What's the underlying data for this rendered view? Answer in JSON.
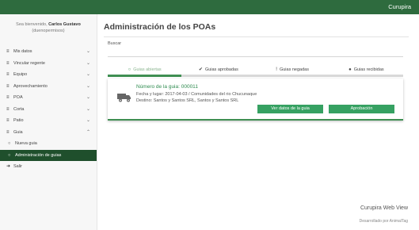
{
  "topbar": {
    "brand": "Curupira"
  },
  "sidebar": {
    "welcome_prefix": "Sea bienvenido,",
    "user_name": "Carlos Gustavo",
    "user_handle": "(duenopermisos)",
    "items": [
      {
        "label": "Mis datos",
        "icon": "bars-icon",
        "chevron": "⌄"
      },
      {
        "label": "Vincular regente",
        "icon": "bars-icon",
        "chevron": "⌄"
      },
      {
        "label": "Equipo",
        "icon": "bars-icon",
        "chevron": "⌄"
      },
      {
        "label": "Aprovechamiento",
        "icon": "bars-icon",
        "chevron": "⌄"
      },
      {
        "label": "POA",
        "icon": "bars-icon",
        "chevron": "⌄"
      },
      {
        "label": "Corta",
        "icon": "bars-icon",
        "chevron": "⌄"
      },
      {
        "label": "Patio",
        "icon": "bars-icon",
        "chevron": "⌄"
      },
      {
        "label": "Guia",
        "icon": "bars-icon",
        "chevron": "⌃"
      },
      {
        "label": "Nueva guia",
        "icon": "circle-icon"
      },
      {
        "label": "Administración de guias",
        "icon": "circle-icon"
      },
      {
        "label": "Salir",
        "icon": "logout-icon"
      }
    ]
  },
  "main": {
    "title": "Administración de los POAs",
    "search_label": "Buscar",
    "search_value": "",
    "tabs": [
      {
        "label": "Guias abiertas",
        "icon": "○"
      },
      {
        "label": "Guias aprobadas",
        "icon": "✔"
      },
      {
        "label": "Guias negadas",
        "icon": "!"
      },
      {
        "label": "Guias recibidas",
        "icon": "●"
      }
    ],
    "card": {
      "number_label": "Número de la guia: 000011",
      "date_line": "Fecha y lugar: 2017-04-03 / Comunidades del rio Chucunaque",
      "dest_line": "Destino: Santos y Santos SRL, Santos y Santos SRL",
      "view_button": "Ver datos de la guia",
      "approve_button": "Aprobación"
    }
  },
  "footer": {
    "title": "Curupira Web View",
    "subtitle": "Desarrollado por AnimalTag"
  },
  "colors": {
    "topbar": "#2e6b3e",
    "accent": "#36a162",
    "active_menu": "#1f4f2c"
  }
}
